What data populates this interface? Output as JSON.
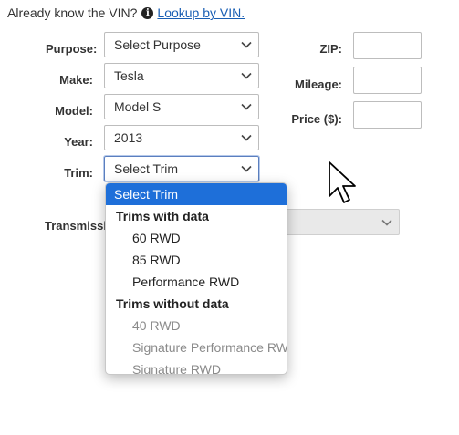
{
  "vin_prompt": {
    "text": "Already know the VIN?",
    "link_label": "Lookup by VIN.",
    "info_icon_glyph": "i"
  },
  "form": {
    "purpose": {
      "label": "Purpose:",
      "value": "Select Purpose"
    },
    "make": {
      "label": "Make:",
      "value": "Tesla"
    },
    "model": {
      "label": "Model:",
      "value": "Model S"
    },
    "year": {
      "label": "Year:",
      "value": "2013"
    },
    "trim": {
      "label": "Trim:",
      "value": "Select Trim"
    },
    "transmission": {
      "label": "Transmissio",
      "value": ""
    },
    "zip": {
      "label": "ZIP:",
      "value": ""
    },
    "mileage": {
      "label": "Mileage:",
      "value": ""
    },
    "price": {
      "label": "Price ($):",
      "value": ""
    }
  },
  "trim_dropdown": {
    "selected_option": "Select Trim",
    "groups": [
      {
        "label": "Trims with data",
        "options": [
          "60 RWD",
          "85 RWD",
          "Performance RWD"
        ]
      },
      {
        "label": "Trims without data",
        "options": [
          "40 RWD",
          "Signature Performance RWD",
          "Signature RWD"
        ]
      }
    ]
  },
  "colors": {
    "accent": "#1e6fd9",
    "link": "#1a5fb4",
    "disabled_text": "#8a8a8a"
  },
  "icons": {
    "info": "info-circle-icon",
    "dropdown": "chevron-down-icon",
    "cursor": "mouse-pointer-icon"
  }
}
